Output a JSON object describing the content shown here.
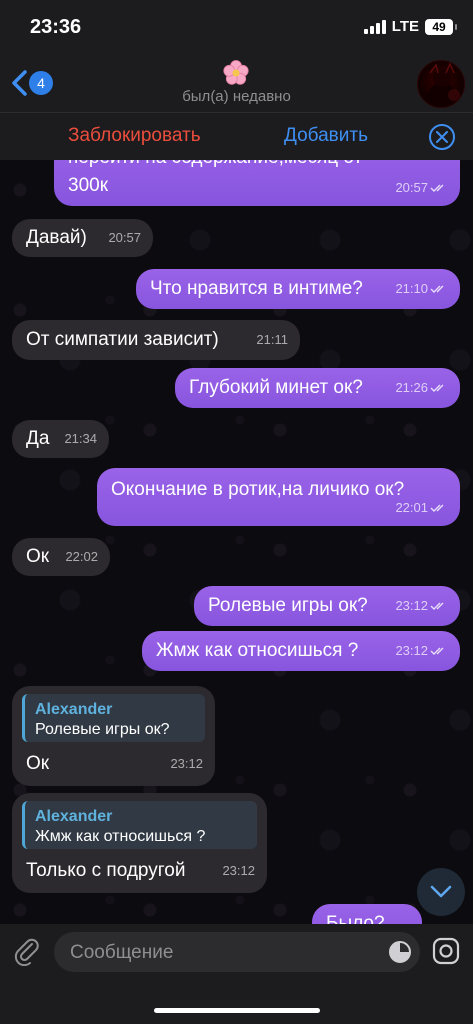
{
  "status_bar": {
    "time": "23:36",
    "network": "LTE",
    "battery": "49"
  },
  "header": {
    "back_badge": "4",
    "emoji": "🌸",
    "status": "был(а) недавно"
  },
  "actions": {
    "block_label": "Заблокировать",
    "add_label": "Добавить"
  },
  "messages": [
    {
      "dir": "out",
      "text_1": "перейти на содержание,месяц от",
      "text_2": "300к",
      "time": "20:57"
    },
    {
      "dir": "in",
      "text": "Давай)",
      "time": "20:57"
    },
    {
      "dir": "out",
      "text": "Что нравится в интиме?",
      "time": "21:10"
    },
    {
      "dir": "in",
      "text": "От симпатии зависит)",
      "time": "21:11"
    },
    {
      "dir": "out",
      "text": "Глубокий минет ок?",
      "time": "21:26"
    },
    {
      "dir": "in",
      "text": "Да",
      "time": "21:34"
    },
    {
      "dir": "out",
      "text": "Окончание в ротик,на личико ок?",
      "time": "22:01"
    },
    {
      "dir": "in",
      "text": "Ок",
      "time": "22:02"
    },
    {
      "dir": "out",
      "text": "Ролевые игры ок?",
      "time": "23:12"
    },
    {
      "dir": "out",
      "text": "Жмж как относишься ?",
      "time": "23:12"
    },
    {
      "dir": "in",
      "reply_name": "Alexander",
      "reply_text": "Ролевые игры ок?",
      "text": "Ок",
      "time": "23:12"
    },
    {
      "dir": "in",
      "reply_name": "Alexander",
      "reply_text": "Жмж как относишься ?",
      "text": "Только с подругой",
      "time": "23:12"
    },
    {
      "dir": "out",
      "text": "Было?"
    }
  ],
  "composer": {
    "placeholder": "Сообщение"
  },
  "colors": {
    "outgoing": "#9a63e8",
    "incoming": "#2c2a2e",
    "accent": "#3f8ff3",
    "danger": "#eb4d3d"
  }
}
